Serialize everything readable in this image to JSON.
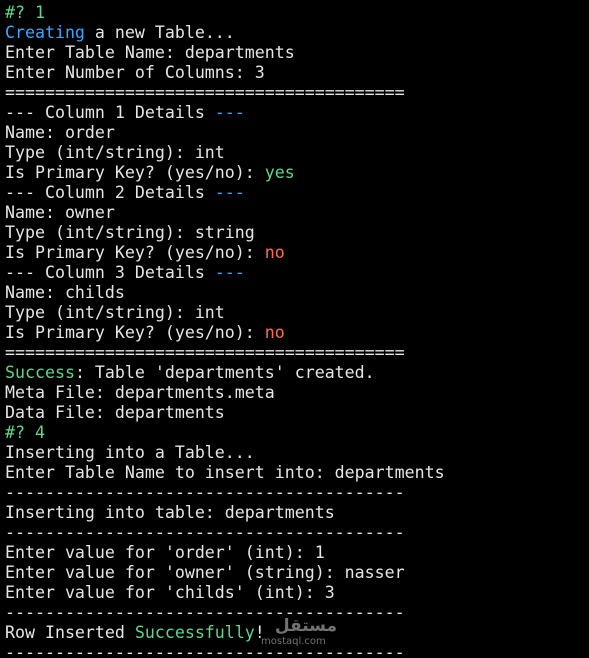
{
  "lines": [
    [
      {
        "text": "#? 1",
        "style": "prompt"
      }
    ],
    [
      {
        "text": "Creating",
        "style": "kw-blue"
      },
      {
        "text": " a new Table..."
      }
    ],
    [
      {
        "text": "Enter Table Name: departments"
      }
    ],
    [
      {
        "text": "Enter Number of Columns: 3"
      }
    ],
    [
      {
        "text": "========================================"
      }
    ],
    [
      {
        "text": "--- Column 1 Details "
      },
      {
        "text": "---",
        "style": "kw-blue"
      }
    ],
    [
      {
        "text": "Name: order"
      }
    ],
    [
      {
        "text": "Type (int/string): int"
      }
    ],
    [
      {
        "text": "Is Primary Key? (yes/no): "
      },
      {
        "text": "yes",
        "style": "kw-green"
      }
    ],
    [
      {
        "text": "--- Column 2 Details "
      },
      {
        "text": "---",
        "style": "kw-blue"
      }
    ],
    [
      {
        "text": "Name: owner"
      }
    ],
    [
      {
        "text": "Type (int/string): string"
      }
    ],
    [
      {
        "text": "Is Primary Key? (yes/no): "
      },
      {
        "text": "no",
        "style": "kw-red"
      }
    ],
    [
      {
        "text": "--- Column 3 Details "
      },
      {
        "text": "---",
        "style": "kw-blue"
      }
    ],
    [
      {
        "text": "Name: childs"
      }
    ],
    [
      {
        "text": "Type (int/string): int"
      }
    ],
    [
      {
        "text": "Is Primary Key? (yes/no): "
      },
      {
        "text": "no",
        "style": "kw-red"
      }
    ],
    [
      {
        "text": "========================================"
      }
    ],
    [
      {
        "text": "Success",
        "style": "kw-green"
      },
      {
        "text": ": Table 'departments' created."
      }
    ],
    [
      {
        "text": "Meta File: departments.meta"
      }
    ],
    [
      {
        "text": "Data File: departments"
      }
    ],
    [
      {
        "text": "#? 4",
        "style": "prompt"
      }
    ],
    [
      {
        "text": "Inserting into a Table..."
      }
    ],
    [
      {
        "text": "Enter Table Name to insert into: departments"
      }
    ],
    [
      {
        "text": "----------------------------------------"
      }
    ],
    [
      {
        "text": "Inserting into table: departments"
      }
    ],
    [
      {
        "text": "----------------------------------------"
      }
    ],
    [
      {
        "text": "Enter value for 'order' (int): 1"
      }
    ],
    [
      {
        "text": "Enter value for 'owner' (string): nasser"
      }
    ],
    [
      {
        "text": "Enter value for 'childs' (int): 3"
      }
    ],
    [
      {
        "text": "----------------------------------------"
      }
    ],
    [
      {
        "text": "Row Inserted "
      },
      {
        "text": "Successfully",
        "style": "kw-green"
      },
      {
        "text": "!"
      }
    ],
    [
      {
        "text": "----------------------------------------"
      }
    ]
  ],
  "watermark": {
    "arabic": "مستقل",
    "latin": "mostaql.com"
  }
}
